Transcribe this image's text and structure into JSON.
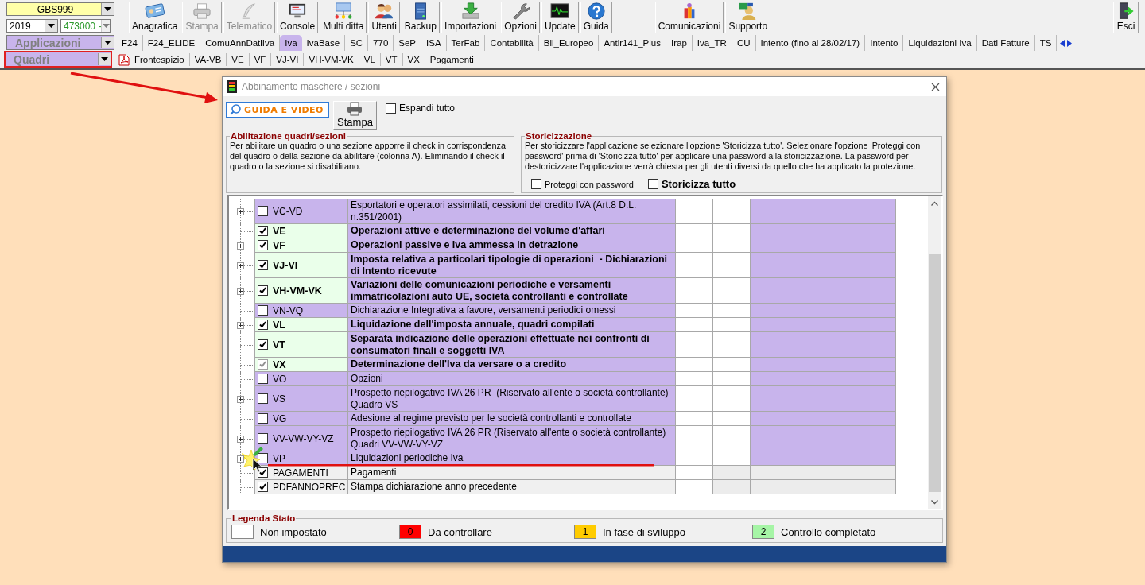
{
  "left_panel": {
    "company": "GBS999",
    "year": "2019",
    "code": "473000 -",
    "applications": "Applicazioni",
    "quadri": "Quadri"
  },
  "toolbar": [
    {
      "label": "Anagrafica",
      "disabled": false
    },
    {
      "label": "Stampa",
      "disabled": true
    },
    {
      "label": "Telematico",
      "disabled": true
    },
    {
      "label": "Console",
      "disabled": false
    },
    {
      "label": "Multi ditta",
      "disabled": false
    },
    {
      "label": "Utenti",
      "disabled": false
    },
    {
      "label": "Backup",
      "disabled": false
    },
    {
      "label": "Importazioni",
      "disabled": false
    },
    {
      "label": "Opzioni",
      "disabled": false
    },
    {
      "label": "Update",
      "disabled": false
    },
    {
      "label": "Guida",
      "disabled": false
    }
  ],
  "toolbar_right": [
    {
      "label": "Comunicazioni",
      "disabled": false
    },
    {
      "label": "Supporto",
      "disabled": false
    }
  ],
  "exit_button": "Esci",
  "app_tabs": [
    {
      "label": "F24",
      "selected": false
    },
    {
      "label": "F24_ELIDE",
      "selected": false
    },
    {
      "label": "ComuAnnDatiIva",
      "selected": false
    },
    {
      "label": "Iva",
      "selected": true
    },
    {
      "label": "IvaBase",
      "selected": false
    },
    {
      "label": "SC",
      "selected": false
    },
    {
      "label": "770",
      "selected": false
    },
    {
      "label": "SeP",
      "selected": false
    },
    {
      "label": "ISA",
      "selected": false
    },
    {
      "label": "TerFab",
      "selected": false
    },
    {
      "label": "Contabilità",
      "selected": false
    },
    {
      "label": "Bil_Europeo",
      "selected": false
    },
    {
      "label": "Antir141_Plus",
      "selected": false
    },
    {
      "label": "Irap",
      "selected": false
    },
    {
      "label": "Iva_TR",
      "selected": false
    },
    {
      "label": "CU",
      "selected": false
    },
    {
      "label": "Intento (fino al 28/02/17)",
      "selected": false
    },
    {
      "label": "Intento",
      "selected": false
    },
    {
      "label": "Liquidazioni Iva",
      "selected": false
    },
    {
      "label": "Dati Fatture",
      "selected": false
    },
    {
      "label": "TS",
      "selected": false
    }
  ],
  "quadri_tabs": [
    "Frontespizio",
    "VA-VB",
    "VE",
    "VF",
    "VJ-VI",
    "VH-VM-VK",
    "VL",
    "VT",
    "VX",
    "Pagamenti"
  ],
  "dialog": {
    "title": "Abbinamento maschere / sezioni",
    "guide_button": "GUIDA E VIDEO",
    "print_button": "Stampa",
    "expand_all": {
      "label": "Espandi tutto",
      "checked": false
    },
    "enable_group": {
      "title": "Abilitazione quadri/sezioni",
      "text": "Per abilitare un quadro o una sezione apporre il check in corrispondenza del quadro o della sezione da abilitare (colonna A). Eliminando il check il quadro o la sezione si disabilitano."
    },
    "history_group": {
      "title": "Storicizzazione",
      "text": "Per storicizzare l'applicazione selezionare l'opzione 'Storicizza tutto'. Selezionare l'opzione 'Proteggi con password' prima di 'Storicizza tutto' per applicare una password alla storicizzazione. La password per destoricizzare l'applicazione verrà chiesta per gli utenti diversi da quello che ha applicato la protezione.",
      "protect": {
        "label": "Proteggi con password",
        "checked": false
      },
      "history_all": {
        "label": "Storicizza tutto",
        "checked": false
      }
    },
    "rows": [
      {
        "code": "VC-VD",
        "description": "Esportatori e operatori assimilati, cessioni del credito IVA (Art.8 D.L. n.351/2001)",
        "checked": false,
        "disabled": false,
        "expandable": true,
        "kind": "section"
      },
      {
        "code": "VE",
        "description": "Operazioni attive e determinazione del volume d'affari",
        "checked": true,
        "disabled": false,
        "expandable": false,
        "kind": "section"
      },
      {
        "code": "VF",
        "description": "Operazioni passive e Iva ammessa in detrazione",
        "checked": true,
        "disabled": false,
        "expandable": true,
        "kind": "section"
      },
      {
        "code": "VJ-VI",
        "description": "Imposta relativa a particolari tipologie di operazioni  - Dichiarazioni di Intento ricevute",
        "checked": true,
        "disabled": false,
        "expandable": true,
        "kind": "section"
      },
      {
        "code": "VH-VM-VK",
        "description": "Variazioni delle comunicazioni periodiche e versamenti immatricolazioni auto UE, società controllanti e controllate",
        "checked": true,
        "disabled": false,
        "expandable": true,
        "kind": "section"
      },
      {
        "code": "VN-VQ",
        "description": "Dichiarazione Integrativa a favore, versamenti periodici omessi",
        "checked": false,
        "disabled": false,
        "expandable": false,
        "kind": "section"
      },
      {
        "code": "VL",
        "description": "Liquidazione dell'imposta annuale, quadri compilati",
        "checked": true,
        "disabled": false,
        "expandable": true,
        "kind": "section"
      },
      {
        "code": "VT",
        "description": "Separata indicazione delle operazioni effettuate nei confronti di consumatori finali e soggetti IVA",
        "checked": true,
        "disabled": false,
        "expandable": false,
        "kind": "section"
      },
      {
        "code": "VX",
        "description": "Determinazione dell'Iva da versare o a credito",
        "checked": true,
        "disabled": true,
        "expandable": false,
        "kind": "section"
      },
      {
        "code": "VO",
        "description": "Opzioni",
        "checked": false,
        "disabled": false,
        "expandable": false,
        "kind": "section"
      },
      {
        "code": "VS",
        "description": "Prospetto riepilogativo IVA 26 PR  (Riservato all'ente o società controllante) Quadro VS",
        "checked": false,
        "disabled": false,
        "expandable": true,
        "kind": "section"
      },
      {
        "code": "VG",
        "description": "Adesione al regime previsto per le società controllanti e controllate",
        "checked": false,
        "disabled": false,
        "expandable": false,
        "kind": "section"
      },
      {
        "code": "VV-VW-VY-VZ",
        "description": "Prospetto riepilogativo IVA 26 PR (Riservato all'ente o società controllante) Quadri VV-VW-VY-VZ",
        "checked": false,
        "disabled": false,
        "expandable": true,
        "kind": "section"
      },
      {
        "code": "VP",
        "description": "Liquidazioni periodiche Iva",
        "checked": false,
        "disabled": false,
        "expandable": true,
        "kind": "section"
      },
      {
        "code": "PAGAMENTI",
        "description": "Pagamenti",
        "checked": true,
        "disabled": false,
        "expandable": false,
        "kind": "extra"
      },
      {
        "code": "PDFANNOPREC",
        "description": "Stampa dichiarazione anno precedente",
        "checked": true,
        "disabled": false,
        "expandable": false,
        "kind": "extra"
      }
    ],
    "legend": {
      "title": "Legenda Stato",
      "items": [
        {
          "label": "Non impostato",
          "color": "#ffffff"
        },
        {
          "badge": "0",
          "label": "Da controllare",
          "color": "#ff0000"
        },
        {
          "badge": "1",
          "label": "In fase di sviluppo",
          "color": "#ffcc00"
        },
        {
          "badge": "2",
          "label": "Controllo completato",
          "color": "#a6f5a6"
        }
      ]
    }
  }
}
